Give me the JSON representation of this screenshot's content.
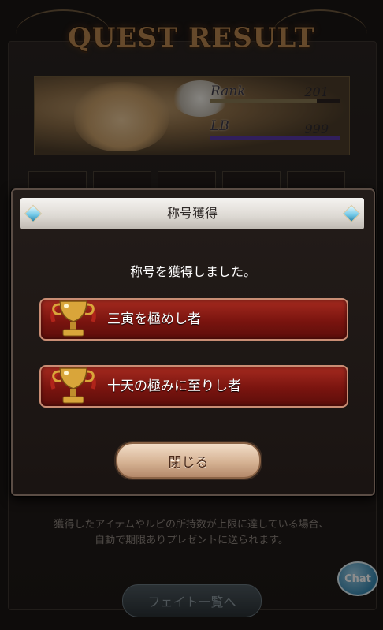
{
  "background": {
    "header_title": "QUEST RESULT",
    "rank_label": "Rank",
    "rank_value": "201",
    "rank_progress": 0.82,
    "lb_label": "LB",
    "lb_value": "999",
    "lb_progress": 1.0,
    "footer_note_line1": "獲得したアイテムやルピの所持数が上限に達している場合、",
    "footer_note_line2": "自動で期限ありプレゼントに送られます。",
    "fate_button_label": "フェイト一覧へ",
    "chat_button_label": "Chat"
  },
  "modal": {
    "title": "称号獲得",
    "message": "称号を獲得しました。",
    "titles": [
      {
        "label": "三寅を極めし者",
        "icon": "trophy-icon"
      },
      {
        "label": "十天の極みに至りし者",
        "icon": "trophy-icon"
      }
    ],
    "close_label": "閉じる"
  },
  "colors": {
    "banner_red": "#8f1d15",
    "banner_border": "#c98d74",
    "rank_bar": "#8a7a55",
    "lb_bar": "#5a3aa8",
    "header_silver": "#dcd8d2"
  }
}
